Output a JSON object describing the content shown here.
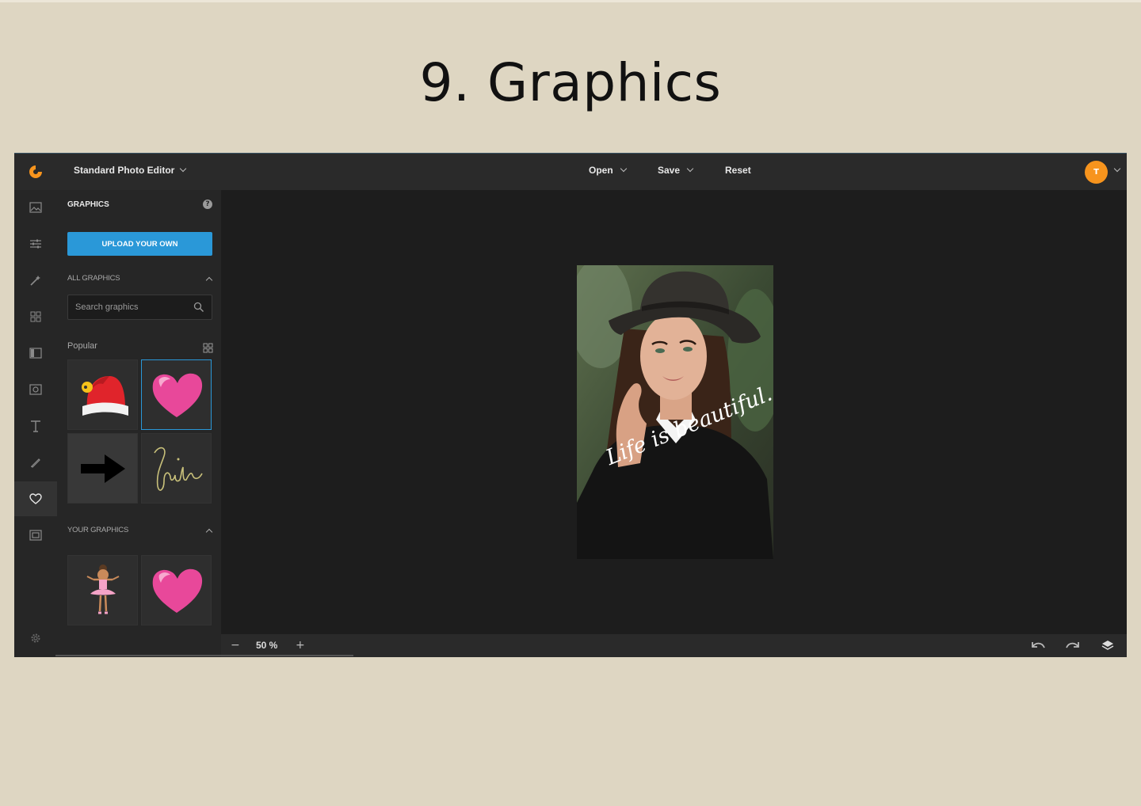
{
  "slide": {
    "title": "9. Graphics"
  },
  "appbar": {
    "editor_select": "Standard Photo Editor",
    "menu": {
      "open": "Open",
      "save": "Save",
      "reset": "Reset"
    },
    "avatar_initial": "T",
    "accent": "#f7941d"
  },
  "rail": {
    "items": [
      "image-icon",
      "sliders-icon",
      "magic-wand-icon",
      "grid-icon",
      "layout-icon",
      "frame-icon",
      "text-icon",
      "brush-icon",
      "graphics-icon",
      "border-icon"
    ],
    "active": "graphics-icon",
    "footer": "gear-icon"
  },
  "panel": {
    "title": "GRAPHICS",
    "help": "?",
    "upload_label": "UPLOAD YOUR OWN",
    "upload_color": "#2a98d8",
    "all_graphics_label": "ALL GRAPHICS",
    "search_placeholder": "Search graphics",
    "popular_label": "Popular",
    "popular_items": [
      "santa-hat-graphic",
      "heart-graphic",
      "arrow-graphic",
      "smile-script-graphic"
    ],
    "your_graphics_label": "YOUR GRAPHICS",
    "your_items": [
      "ballerina-graphic",
      "heart-graphic"
    ]
  },
  "canvas": {
    "caption": "Life is beautiful."
  },
  "bottombar": {
    "zoom_minus": "−",
    "zoom_value": "50 %",
    "zoom_plus": "+"
  }
}
